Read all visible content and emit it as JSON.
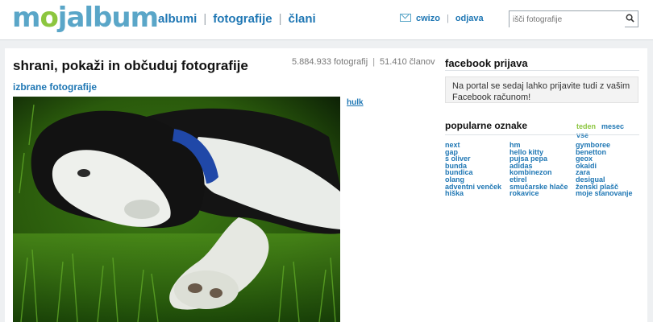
{
  "brand": {
    "logo_start": "m",
    "logo_o": "o",
    "logo_end": "jalbum"
  },
  "nav": {
    "albums": "albumi",
    "photos": "fotografije",
    "members": "člani"
  },
  "user": {
    "name": "cwizo",
    "logout": "odjava"
  },
  "search": {
    "placeholder": "išči fotografije"
  },
  "main": {
    "title": "shrani, pokaži in občuduj fotografije",
    "photos_count": "5.884.933 fotografij",
    "members_count": "51.410 članov",
    "featured_label": "izbrane fotografije",
    "photo_author": "hulk"
  },
  "facebook": {
    "title": "facebook prijava",
    "message": "Na portal se sedaj lahko prijavite tudi z vašim Facebook računom!"
  },
  "tags": {
    "title": "popularne oznake",
    "periods": {
      "day": "teden",
      "month": "mesec",
      "all": "vse"
    },
    "col1": [
      "next",
      "gap",
      "s oliver",
      "bunda",
      "bundica",
      "olang",
      "adventni venček",
      "hiška"
    ],
    "col2": [
      "hm",
      "hello kitty",
      "pujsa pepa",
      "adidas",
      "kombinezon",
      "etirel",
      "smučarske hlače",
      "rokavice"
    ],
    "col3": [
      "gymboree",
      "benetton",
      "geox",
      "okaidi",
      "zara",
      "desigual",
      "ženski plašč",
      "moje stanovanje"
    ]
  },
  "colors": {
    "link": "#1f77b4",
    "brand_blue": "#5aa6c8",
    "brand_green": "#8cc63f",
    "active_period": "#8cc63f"
  }
}
